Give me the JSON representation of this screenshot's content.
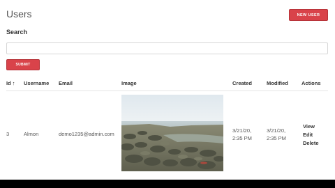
{
  "page": {
    "title": "Users",
    "new_user_label": "NEW USER"
  },
  "search": {
    "label": "Search",
    "value": "",
    "placeholder": "",
    "submit_label": "SUBMIT"
  },
  "table": {
    "headers": {
      "id": "Id",
      "id_sort_indicator": "↑",
      "username": "Username",
      "email": "Email",
      "image": "Image",
      "created": "Created",
      "modified": "Modified",
      "actions": "Actions"
    },
    "rows": [
      {
        "id": "3",
        "username": "Almon",
        "email": "demo1235@admin.com",
        "created_date": "3/21/20,",
        "created_time": "2:35 PM",
        "modified_date": "3/21/20,",
        "modified_time": "2:35 PM",
        "actions": {
          "view": "View",
          "edit": "Edit",
          "delete": "Delete"
        }
      }
    ]
  },
  "colors": {
    "accent": "#d9434a",
    "background": "#ffffff"
  },
  "icons": {
    "sort": "sort-ascending-icon"
  }
}
